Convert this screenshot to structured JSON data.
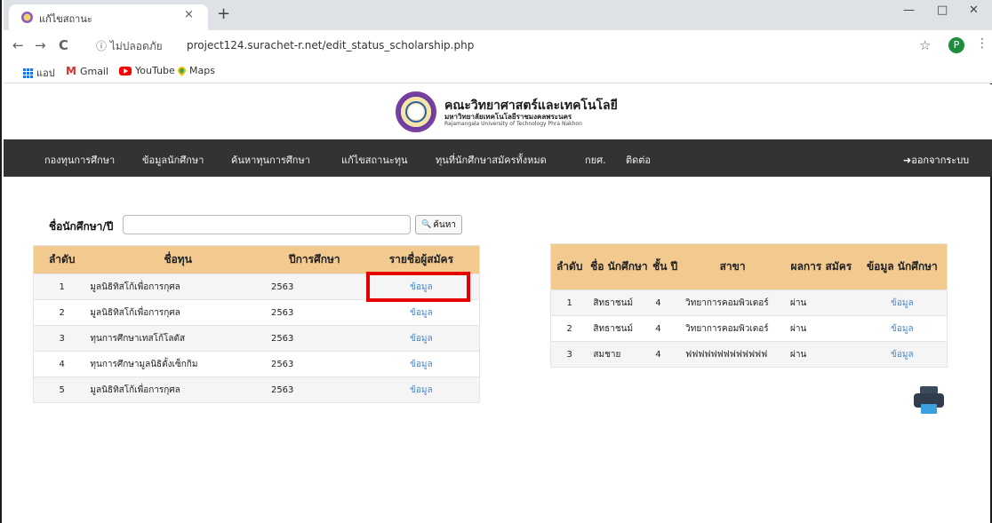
{
  "browser": {
    "tab_title": "แก้ไขสถานะ",
    "tab_close": "×",
    "new_tab": "+",
    "minimize": "—",
    "restore": "□",
    "close": "✕",
    "back": "←",
    "forward": "→",
    "reload": "C",
    "security_label": "ⓘ ไม่ปลอดภัย",
    "url": "project124.surachet-r.net/edit_status_scholarship.php",
    "star": "☆",
    "profile_letter": "P",
    "menu": "⋮",
    "bookmarks": {
      "apps": "แอป",
      "gmail": "Gmail",
      "youtube": "YouTube",
      "maps": "Maps"
    }
  },
  "site": {
    "logo_line1": "คณะวิทยาศาสตร์และเทคโนโลยี",
    "logo_line2": "มหาวิทยาลัยเทคโนโลยีราชมงคลพระนคร",
    "logo_line3": "Rajamangala University of Technology Phra Nakhon"
  },
  "nav": {
    "items": [
      "กองทุนการศึกษา",
      "ข้อมูลนักศึกษา",
      "ค้นหาทุนการศึกษา",
      "แก้ไขสถานะทุน",
      "ทุนที่นักศึกษาสมัครทั้งหมด",
      "กยศ.",
      "ติดต่อ"
    ],
    "logout": "➜ออกจากระบบ"
  },
  "search": {
    "label": "ชื่อนักศึกษา/ปี",
    "placeholder": "",
    "button_icon": "🔍",
    "button_label": "ค้นหา"
  },
  "scholarships": {
    "headers": [
      "ลำดับ",
      "ชื่อทุน",
      "ปีการศึกษา",
      "รายชื่อผู้สมัคร"
    ],
    "rows": [
      [
        "1",
        "มูลนิธิทิสโก้เพื่อการกุศล",
        "2563",
        "ข้อมูล"
      ],
      [
        "2",
        "มูลนิธิทิสโก้เพื่อการกุศล",
        "2563",
        "ข้อมูล"
      ],
      [
        "3",
        "ทุนการศึกษาเทสโก้โลตัส",
        "2563",
        "ข้อมูล"
      ],
      [
        "4",
        "ทุนการศึกษามูลนิธิตั้งเซ็กกิม",
        "2563",
        "ข้อมูล"
      ],
      [
        "5",
        "มูลนิธิทิสโก้เพื่อการกุศล",
        "2563",
        "ข้อมูล"
      ]
    ]
  },
  "applicants": {
    "headers": [
      "ลำดับ",
      "ชื่อ นักศึกษา",
      "ชั้น ปี",
      "สาขา",
      "ผลการ สมัคร",
      "ข้อมูล นักศึกษา"
    ],
    "rows": [
      [
        "1",
        "สิทธาชนม์",
        "4",
        "วิทยาการคอมพิวเตอร์",
        "ผ่าน",
        "ข้อมูล"
      ],
      [
        "2",
        "สิทธาชนม์",
        "4",
        "วิทยาการคอมพิวเตอร์",
        "ผ่าน",
        "ข้อมูล"
      ],
      [
        "3",
        "สมชาย",
        "4",
        "ฟฟฟฟฟฟฟฟฟฟฟฟฟ",
        "ผ่าน",
        "ข้อมูล"
      ]
    ]
  }
}
